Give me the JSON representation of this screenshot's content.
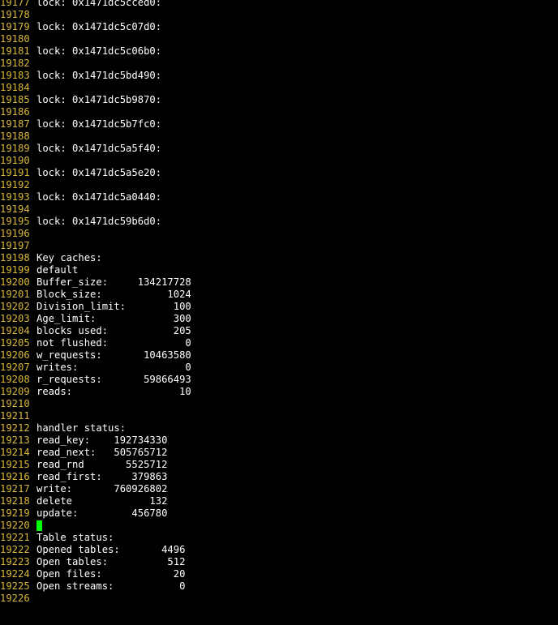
{
  "terminal": {
    "cursor_line": "19220",
    "colors": {
      "background": "#000000",
      "line_number": "#d7b83a",
      "text": "#ffffff",
      "cursor": "#00ff00"
    },
    "lines": [
      {
        "n": "19177",
        "t": "lock: 0x1471dc5cced0:"
      },
      {
        "n": "19178",
        "t": ""
      },
      {
        "n": "19179",
        "t": "lock: 0x1471dc5c07d0:"
      },
      {
        "n": "19180",
        "t": ""
      },
      {
        "n": "19181",
        "t": "lock: 0x1471dc5c06b0:"
      },
      {
        "n": "19182",
        "t": ""
      },
      {
        "n": "19183",
        "t": "lock: 0x1471dc5bd490:"
      },
      {
        "n": "19184",
        "t": ""
      },
      {
        "n": "19185",
        "t": "lock: 0x1471dc5b9870:"
      },
      {
        "n": "19186",
        "t": ""
      },
      {
        "n": "19187",
        "t": "lock: 0x1471dc5b7fc0:"
      },
      {
        "n": "19188",
        "t": ""
      },
      {
        "n": "19189",
        "t": "lock: 0x1471dc5a5f40:"
      },
      {
        "n": "19190",
        "t": ""
      },
      {
        "n": "19191",
        "t": "lock: 0x1471dc5a5e20:"
      },
      {
        "n": "19192",
        "t": ""
      },
      {
        "n": "19193",
        "t": "lock: 0x1471dc5a0440:"
      },
      {
        "n": "19194",
        "t": ""
      },
      {
        "n": "19195",
        "t": "lock: 0x1471dc59b6d0:"
      },
      {
        "n": "19196",
        "t": ""
      },
      {
        "n": "19197",
        "t": ""
      },
      {
        "n": "19198",
        "t": "Key caches:"
      },
      {
        "n": "19199",
        "t": "default"
      },
      {
        "n": "19200",
        "t": "Buffer_size:     134217728"
      },
      {
        "n": "19201",
        "t": "Block_size:           1024"
      },
      {
        "n": "19202",
        "t": "Division_limit:        100"
      },
      {
        "n": "19203",
        "t": "Age_limit:             300"
      },
      {
        "n": "19204",
        "t": "blocks used:           205"
      },
      {
        "n": "19205",
        "t": "not flushed:             0"
      },
      {
        "n": "19206",
        "t": "w_requests:       10463580"
      },
      {
        "n": "19207",
        "t": "writes:                  0"
      },
      {
        "n": "19208",
        "t": "r_requests:       59866493"
      },
      {
        "n": "19209",
        "t": "reads:                  10"
      },
      {
        "n": "19210",
        "t": ""
      },
      {
        "n": "19211",
        "t": ""
      },
      {
        "n": "19212",
        "t": "handler status:"
      },
      {
        "n": "19213",
        "t": "read_key:    192734330"
      },
      {
        "n": "19214",
        "t": "read_next:   505765712"
      },
      {
        "n": "19215",
        "t": "read_rnd       5525712"
      },
      {
        "n": "19216",
        "t": "read_first:     379863"
      },
      {
        "n": "19217",
        "t": "write:       760926802"
      },
      {
        "n": "19218",
        "t": "delete             132"
      },
      {
        "n": "19219",
        "t": "update:         456780"
      },
      {
        "n": "19220",
        "t": ""
      },
      {
        "n": "19221",
        "t": "Table status:"
      },
      {
        "n": "19222",
        "t": "Opened tables:       4496"
      },
      {
        "n": "19223",
        "t": "Open tables:          512"
      },
      {
        "n": "19224",
        "t": "Open files:            20"
      },
      {
        "n": "19225",
        "t": "Open streams:           0"
      },
      {
        "n": "19226",
        "t": ""
      }
    ]
  }
}
